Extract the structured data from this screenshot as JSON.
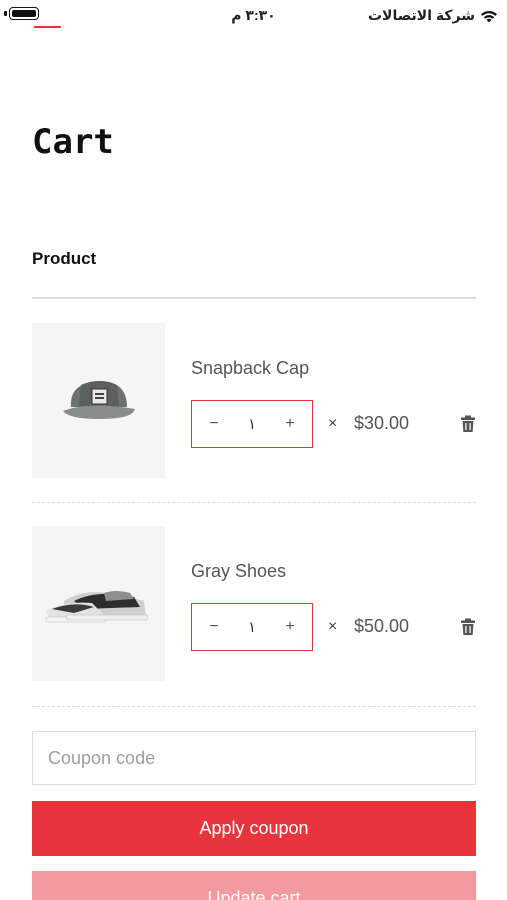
{
  "status_bar": {
    "time": "٣:٣٠ م",
    "carrier": "شركة الاتصالات"
  },
  "page": {
    "title": "Cart",
    "column_header": "Product"
  },
  "cart": {
    "items": [
      {
        "name": "Snapback Cap",
        "quantity": "١",
        "times": "×",
        "price": "$30.00",
        "image_icon": "cap-image"
      },
      {
        "name": "Gray Shoes",
        "quantity": "١",
        "times": "×",
        "price": "$50.00",
        "image_icon": "shoes-image"
      }
    ],
    "qty_minus": "−",
    "qty_plus": "+"
  },
  "coupon": {
    "placeholder": "Coupon code",
    "value": ""
  },
  "buttons": {
    "apply": "Apply coupon",
    "update": "Update cart"
  },
  "colors": {
    "accent": "#e8343b",
    "accent_disabled": "#f29a9d"
  }
}
